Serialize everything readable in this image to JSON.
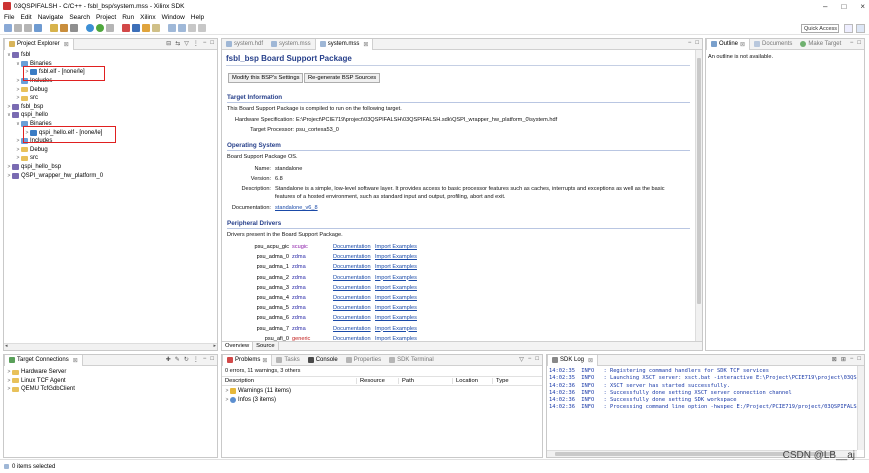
{
  "window": {
    "title": "03QSPIFALSH - C/C++ - fsbl_bsp/system.mss - Xilinx SDK",
    "minimize": "–",
    "maximize": "□",
    "close": "×"
  },
  "menu": [
    "File",
    "Edit",
    "Navigate",
    "Search",
    "Project",
    "Run",
    "Xilinx",
    "Window",
    "Help"
  ],
  "toolbar": {
    "quick_access": "Quick Access"
  },
  "project_explorer": {
    "tab": "Project Explorer",
    "items": [
      {
        "label": "fsbl",
        "indent": 0,
        "twisty": "∨",
        "icon": "proj"
      },
      {
        "label": "Binaries",
        "indent": 1,
        "twisty": "∨",
        "icon": "bin"
      },
      {
        "label": "fsbl.elf - [none/le]",
        "indent": 2,
        "twisty": ">",
        "icon": "elf"
      },
      {
        "label": "Includes",
        "indent": 1,
        "twisty": ">",
        "icon": "bin"
      },
      {
        "label": "Debug",
        "indent": 1,
        "twisty": ">",
        "icon": "folder"
      },
      {
        "label": "src",
        "indent": 1,
        "twisty": ">",
        "icon": "folder"
      },
      {
        "label": "fsbl_bsp",
        "indent": 0,
        "twisty": ">",
        "icon": "proj"
      },
      {
        "label": "qspi_hello",
        "indent": 0,
        "twisty": "∨",
        "icon": "proj"
      },
      {
        "label": "Binaries",
        "indent": 1,
        "twisty": "∨",
        "icon": "bin"
      },
      {
        "label": "qspi_hello.elf - [none/le]",
        "indent": 2,
        "twisty": ">",
        "icon": "elf"
      },
      {
        "label": "Includes",
        "indent": 1,
        "twisty": ">",
        "icon": "bin"
      },
      {
        "label": "Debug",
        "indent": 1,
        "twisty": ">",
        "icon": "folder"
      },
      {
        "label": "src",
        "indent": 1,
        "twisty": ">",
        "icon": "folder"
      },
      {
        "label": "qspi_hello_bsp",
        "indent": 0,
        "twisty": ">",
        "icon": "proj"
      },
      {
        "label": "QSPI_wrapper_hw_platform_0",
        "indent": 0,
        "twisty": ">",
        "icon": "proj"
      }
    ]
  },
  "editor": {
    "tabs": [
      "system.hdf",
      "system.mss",
      "system.mss"
    ],
    "heading": "fsbl_bsp Board Support Package",
    "btn_modify": "Modify this BSP's Settings",
    "btn_regen": "Re-generate BSP Sources",
    "target": {
      "title": "Target Information",
      "desc": "This Board Support Package is compiled to run on the following target.",
      "hw_label": "Hardware Specification:",
      "hw_value": "E:\\Project\\PCIE719\\project\\03QSPIFALSH\\03QSPIFALSH.sdk\\QSPI_wrapper_hw_platform_0\\system.hdf",
      "proc_label": "Target Processor:",
      "proc_value": "psu_cortexa53_0"
    },
    "os": {
      "title": "Operating System",
      "desc": "Board Support Package OS.",
      "name_label": "Name:",
      "name_value": "standalone",
      "ver_label": "Version:",
      "ver_value": "6.8",
      "desc_label": "Description:",
      "desc_value1": "Standalone is a simple, low-level software layer. It provides access to basic processor features such as caches, interrupts and exceptions as well as the basic",
      "desc_value2": "features of a hosted environment, such as standard input and output, profiling, abort and exit.",
      "doc_label": "Documentation:",
      "doc_value": "standalone_v6_8"
    },
    "drivers": {
      "title": "Peripheral Drivers",
      "desc": "Drivers present in the Board Support Package.",
      "doc_link": "Documentation",
      "ex_link": "Import Examples",
      "rows": [
        {
          "name": "psu_acpu_gic",
          "drv": "scugic",
          "color": "#8a1aa8"
        },
        {
          "name": "psu_adma_0",
          "drv": "zdma",
          "color": "#2a2aa8"
        },
        {
          "name": "psu_adma_1",
          "drv": "zdma",
          "color": "#2a2aa8"
        },
        {
          "name": "psu_adma_2",
          "drv": "zdma",
          "color": "#2a2aa8"
        },
        {
          "name": "psu_adma_3",
          "drv": "zdma",
          "color": "#2a2aa8"
        },
        {
          "name": "psu_adma_4",
          "drv": "zdma",
          "color": "#2a2aa8"
        },
        {
          "name": "psu_adma_5",
          "drv": "zdma",
          "color": "#2a2aa8"
        },
        {
          "name": "psu_adma_6",
          "drv": "zdma",
          "color": "#2a2aa8"
        },
        {
          "name": "psu_adma_7",
          "drv": "zdma",
          "color": "#2a2aa8"
        },
        {
          "name": "psu_afi_0",
          "drv": "generic",
          "color": "#c01818"
        }
      ]
    },
    "bottom_tabs": [
      "Overview",
      "Source"
    ]
  },
  "outline": {
    "tab_outline": "Outline",
    "tab_docs": "Documents",
    "tab_target": "Make Target",
    "message": "An outline is not available."
  },
  "target_connections": {
    "tab": "Target Connections",
    "items": [
      "Hardware Server",
      "Linux TCF Agent",
      "QEMU TcfGdbClient"
    ]
  },
  "problems": {
    "tabs": [
      "Problems",
      "Tasks",
      "Console",
      "Properties",
      "SDK Terminal"
    ],
    "summary": "0 errors, 11 warnings, 3 others",
    "columns": [
      "Description",
      "Resource",
      "Path",
      "Location",
      "Type"
    ],
    "rows": [
      {
        "label": "Warnings (11 items)"
      },
      {
        "label": "Infos (3 items)"
      }
    ]
  },
  "sdk_log": {
    "tab": "SDK Log",
    "lines": [
      {
        "time": "14:02:35",
        "level": "INFO",
        "msg": ": Registering command handlers for SDK TCF services"
      },
      {
        "time": "14:02:35",
        "level": "INFO",
        "msg": ": Launching XSCT server: xsct.bat -interactive E:\\Project\\PCIE719\\project\\03QSPIF"
      },
      {
        "time": "14:02:36",
        "level": "INFO",
        "msg": ": XSCT server has started successfully."
      },
      {
        "time": "14:02:36",
        "level": "INFO",
        "msg": ": Successfully done setting XSCT server connection channel"
      },
      {
        "time": "14:02:36",
        "level": "INFO",
        "msg": ": Successfully done setting SDK workspace"
      },
      {
        "time": "14:02:36",
        "level": "INFO",
        "msg": ": Processing command line option -hwspec E:/Project/PCIE719/project/03QSPIFALSH/0"
      }
    ]
  },
  "status": {
    "text": "0 items selected",
    "watermark": "CSDN @LB__aj"
  }
}
